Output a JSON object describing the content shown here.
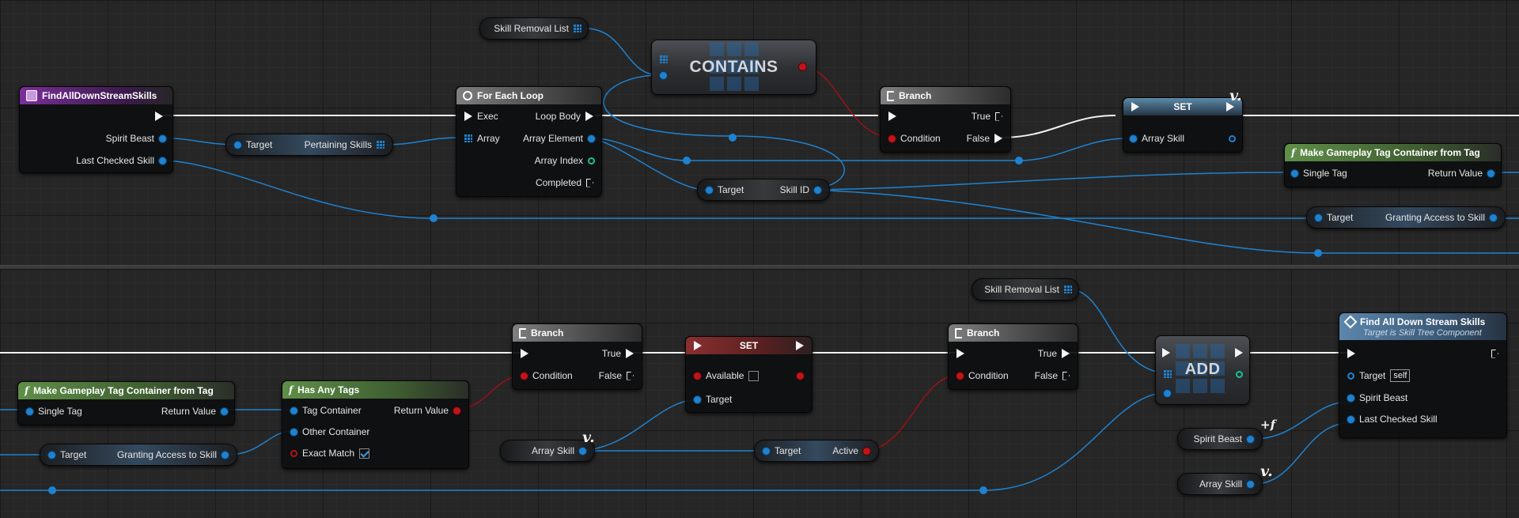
{
  "graph": {
    "top": {
      "find_node": {
        "title": "FindAllDownStreamSkills",
        "pins": [
          "Spirit Beast",
          "Last Checked Skill"
        ]
      },
      "skill_removal_list": "Skill Removal List",
      "contains": {
        "title": "CONTAINS"
      },
      "pertaining": {
        "target": "Target",
        "output": "Pertaining Skills"
      },
      "for_each": {
        "title": "For Each Loop",
        "exec": "Exec",
        "array": "Array",
        "loop_body": "Loop Body",
        "array_element": "Array Element",
        "array_index": "Array Index",
        "completed": "Completed"
      },
      "skill_id": {
        "target": "Target",
        "output": "Skill ID"
      },
      "branch": {
        "title": "Branch",
        "condition": "Condition",
        "true": "True",
        "false": "False"
      },
      "set": {
        "title": "SET",
        "pin": "Array Skill"
      },
      "make_tag": {
        "title": "Make Gameplay Tag Container from Tag",
        "input": "Single Tag",
        "output": "Return Value"
      },
      "granting": {
        "target": "Target",
        "output": "Granting Access to Skill"
      }
    },
    "bottom": {
      "make_tag": {
        "title": "Make Gameplay Tag Container from Tag",
        "input": "Single Tag",
        "output": "Return Value"
      },
      "granting": {
        "target": "Target",
        "output": "Granting Access to Skill"
      },
      "has_any_tags": {
        "title": "Has Any Tags",
        "tag_container": "Tag Container",
        "other_container": "Other Container",
        "exact_match": "Exact Match",
        "return_value": "Return Value",
        "exact_match_checked": true
      },
      "branch1": {
        "title": "Branch",
        "condition": "Condition",
        "true": "True",
        "false": "False"
      },
      "array_skill_get": "Array Skill",
      "set_available": {
        "title": "SET",
        "available": "Available",
        "target": "Target",
        "available_checked": false
      },
      "active": {
        "target": "Target",
        "output": "Active"
      },
      "skill_removal_list": "Skill Removal List",
      "branch2": {
        "title": "Branch",
        "condition": "Condition",
        "true": "True",
        "false": "False"
      },
      "add": {
        "title": "ADD"
      },
      "find_call": {
        "title": "Find All Down Stream Skills",
        "subtitle": "Target is Skill Tree Component",
        "target": "Target",
        "self": "self",
        "spirit_beast": "Spirit Beast",
        "last_checked": "Last Checked Skill"
      },
      "spirit_beast_get": "Spirit Beast",
      "array_skill_get2": "Array Skill"
    }
  },
  "colors": {
    "exec_wire": "#f2f2f2",
    "object_wire": "#1f82d0",
    "bool_wire": "#9a1116",
    "int_wire": "#18c49a",
    "function_header": "#7a2f9b",
    "pure_function_header": "#5f8f48",
    "flow_header": "#7f7f7f",
    "variable_set_header": "#5c86ab"
  },
  "icons": [
    "function-entry-icon",
    "loop-icon",
    "branch-icon",
    "function-f-icon",
    "variable-v-icon",
    "call-function-icon",
    "array-grid-icon"
  ]
}
